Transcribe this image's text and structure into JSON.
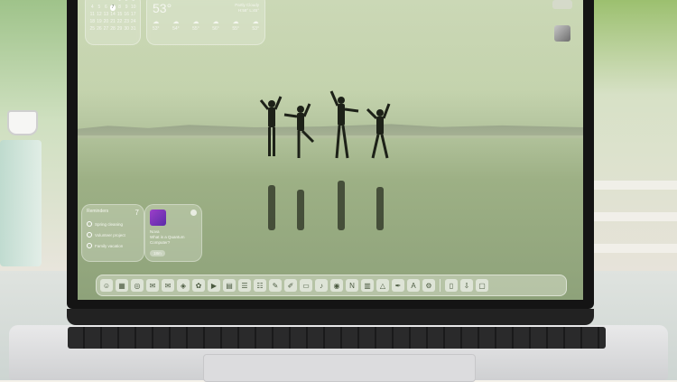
{
  "calendar": {
    "days": [
      "",
      "",
      "",
      "",
      "1",
      "2",
      "3",
      "4",
      "5",
      "6",
      "7",
      "8",
      "9",
      "10",
      "11",
      "12",
      "13",
      "14",
      "15",
      "16",
      "17",
      "18",
      "19",
      "20",
      "21",
      "22",
      "23",
      "24",
      "25",
      "26",
      "27",
      "28",
      "29",
      "30",
      "31"
    ],
    "today_index": 10
  },
  "weather": {
    "temp": "53°",
    "location": "Partly Cloudy",
    "range": "H:58° L:45°",
    "hours": [
      {
        "temp": "53°"
      },
      {
        "temp": "54°"
      },
      {
        "temp": "55°"
      },
      {
        "temp": "56°"
      },
      {
        "temp": "55°"
      },
      {
        "temp": "53°"
      }
    ]
  },
  "reminders": {
    "title": "Reminders",
    "count": "7",
    "items": [
      "Spring cleaning",
      "Volunteer project",
      "Family vacation"
    ]
  },
  "podcast": {
    "show": "Nova",
    "episode": "What is a Quantum Computer?",
    "time": "18m"
  },
  "dock": {
    "icons": [
      "finder-icon",
      "launchpad-icon",
      "safari-icon",
      "messages-icon",
      "mail-icon",
      "maps-icon",
      "photos-icon",
      "facetime-icon",
      "calendar-icon",
      "contacts-icon",
      "reminders-icon",
      "notes-icon",
      "freeform-icon",
      "tv-icon",
      "music-icon",
      "podcasts-icon",
      "news-icon",
      "numbers-icon",
      "keynote-icon",
      "pages-icon",
      "appstore-icon",
      "settings-icon",
      "iphone-mirroring-icon",
      "downloads-icon",
      "trash-icon"
    ]
  },
  "colors": {
    "accent": "#9c3fc9",
    "widget_text": "#f4f6ef"
  }
}
